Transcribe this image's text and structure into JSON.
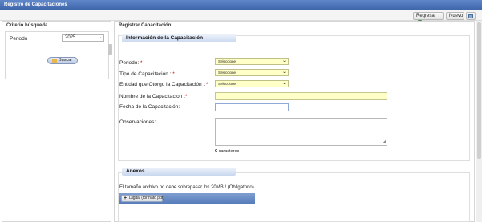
{
  "window": {
    "title": "Registro de Capacitaciones"
  },
  "toolbar": {
    "regresar_label": "Regresar",
    "nuevo_label": "Nuevo"
  },
  "left_panel": {
    "header": "Criterio búsqueda",
    "periodo_label": "Periodo",
    "periodo_value": "2025",
    "buscar_label": "Buscar"
  },
  "right_panel": {
    "header": "Registrar Capacitación",
    "info_section": {
      "legend": "Información de la Capacitación",
      "periodo_label": "Periodo:",
      "periodo_value": "Seleccione",
      "tipo_label": "Tipo de Capacitación :",
      "tipo_value": "Seleccione",
      "entidad_label": "Entidad que Otorgo la Capacitación :",
      "entidad_value": "Seleccione",
      "nombre_label": "Nombre de la Capacitacion :",
      "nombre_value": "",
      "fecha_label": "Fecha de la Capacitación:",
      "fecha_value": "",
      "observaciones_label": "Observaciones:",
      "observaciones_value": "",
      "char_count": "0",
      "char_count_suffix": "caracteres",
      "required_mark": "*"
    },
    "anexos_section": {
      "legend": "Anexos",
      "note": "El tamaño archivo no debe sobrepasar los 20MB / (Obligatorio).",
      "upload_label": "Digital (formato pdf)"
    }
  },
  "colors": {
    "titlebar": "#3d63a8",
    "required": "#cc0000",
    "select_bg": "#ffffc8",
    "upload_bar": "#5579b8"
  }
}
